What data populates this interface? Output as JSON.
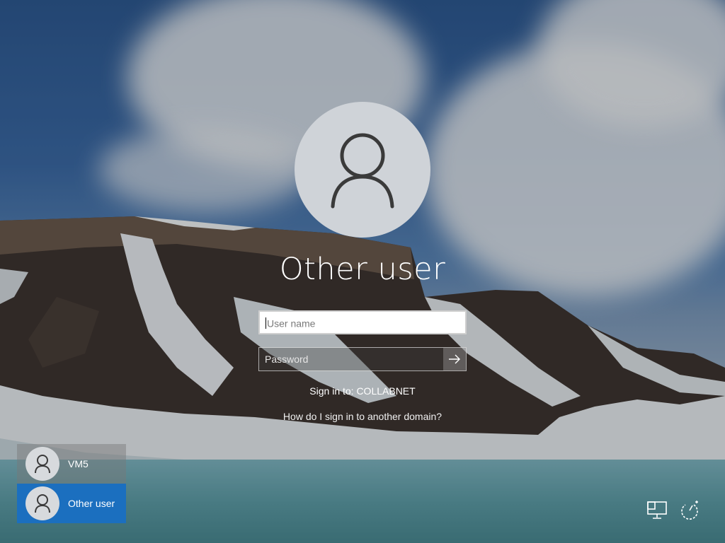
{
  "login": {
    "title": "Other user",
    "username_placeholder": "User name",
    "password_placeholder": "Password",
    "sign_in_to": "Sign in to: COLLABNET",
    "other_domain_link": "How do I sign in to another domain?"
  },
  "users": [
    {
      "name": "VM5",
      "selected": false
    },
    {
      "name": "Other user",
      "selected": true
    }
  ],
  "system_icons": [
    "network-icon",
    "power-icon"
  ],
  "colors": {
    "selected_tile": "#1b6fbf",
    "avatar_bg": "#cfd3d8",
    "field_bg": "#ffffff"
  }
}
